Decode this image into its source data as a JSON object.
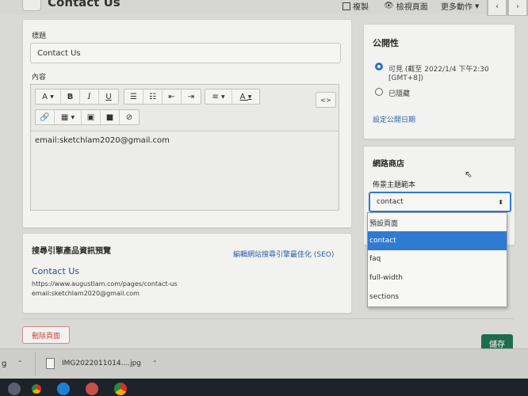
{
  "header": {
    "title": "Contact Us",
    "actions": {
      "copy": "複製",
      "view": "檢視頁面",
      "more": "更多動作"
    }
  },
  "editor": {
    "title_label": "標題",
    "title_value": "Contact Us",
    "content_label": "內容",
    "body_text": "email:sketchlam2020@gmail.com"
  },
  "seo": {
    "heading": "搜尋引擎產品資訊預覽",
    "edit_link": "編輯網站搜尋引擎最佳化 (SEO)",
    "preview_title": "Contact Us",
    "preview_url": "https://www.augustlam.com/pages/contact-us",
    "preview_desc": "email:sketchlam2020@gmail.com"
  },
  "visibility": {
    "heading": "公開性",
    "visible_label": "可見 (截至 2022/1/4 下午2:30",
    "visible_label_2": "[GMT+8])",
    "hidden_label": "已隱藏",
    "set_date_link": "設定公開日期"
  },
  "store": {
    "heading": "網路商店",
    "template_label": "佈景主題範本",
    "selected": "contact",
    "options": [
      "預設頁面",
      "contact",
      "faq",
      "full-width",
      "sections"
    ],
    "selected_index": 1
  },
  "buttons": {
    "delete": "刪除頁面",
    "save": "儲存"
  },
  "downloads": {
    "prefix": "g",
    "filename": "IMG2022011014....jpg"
  },
  "colors": {
    "accent": "#2f7bd1",
    "save": "#1f6b4d",
    "danger": "#c64545",
    "link": "#2d5fa8"
  }
}
